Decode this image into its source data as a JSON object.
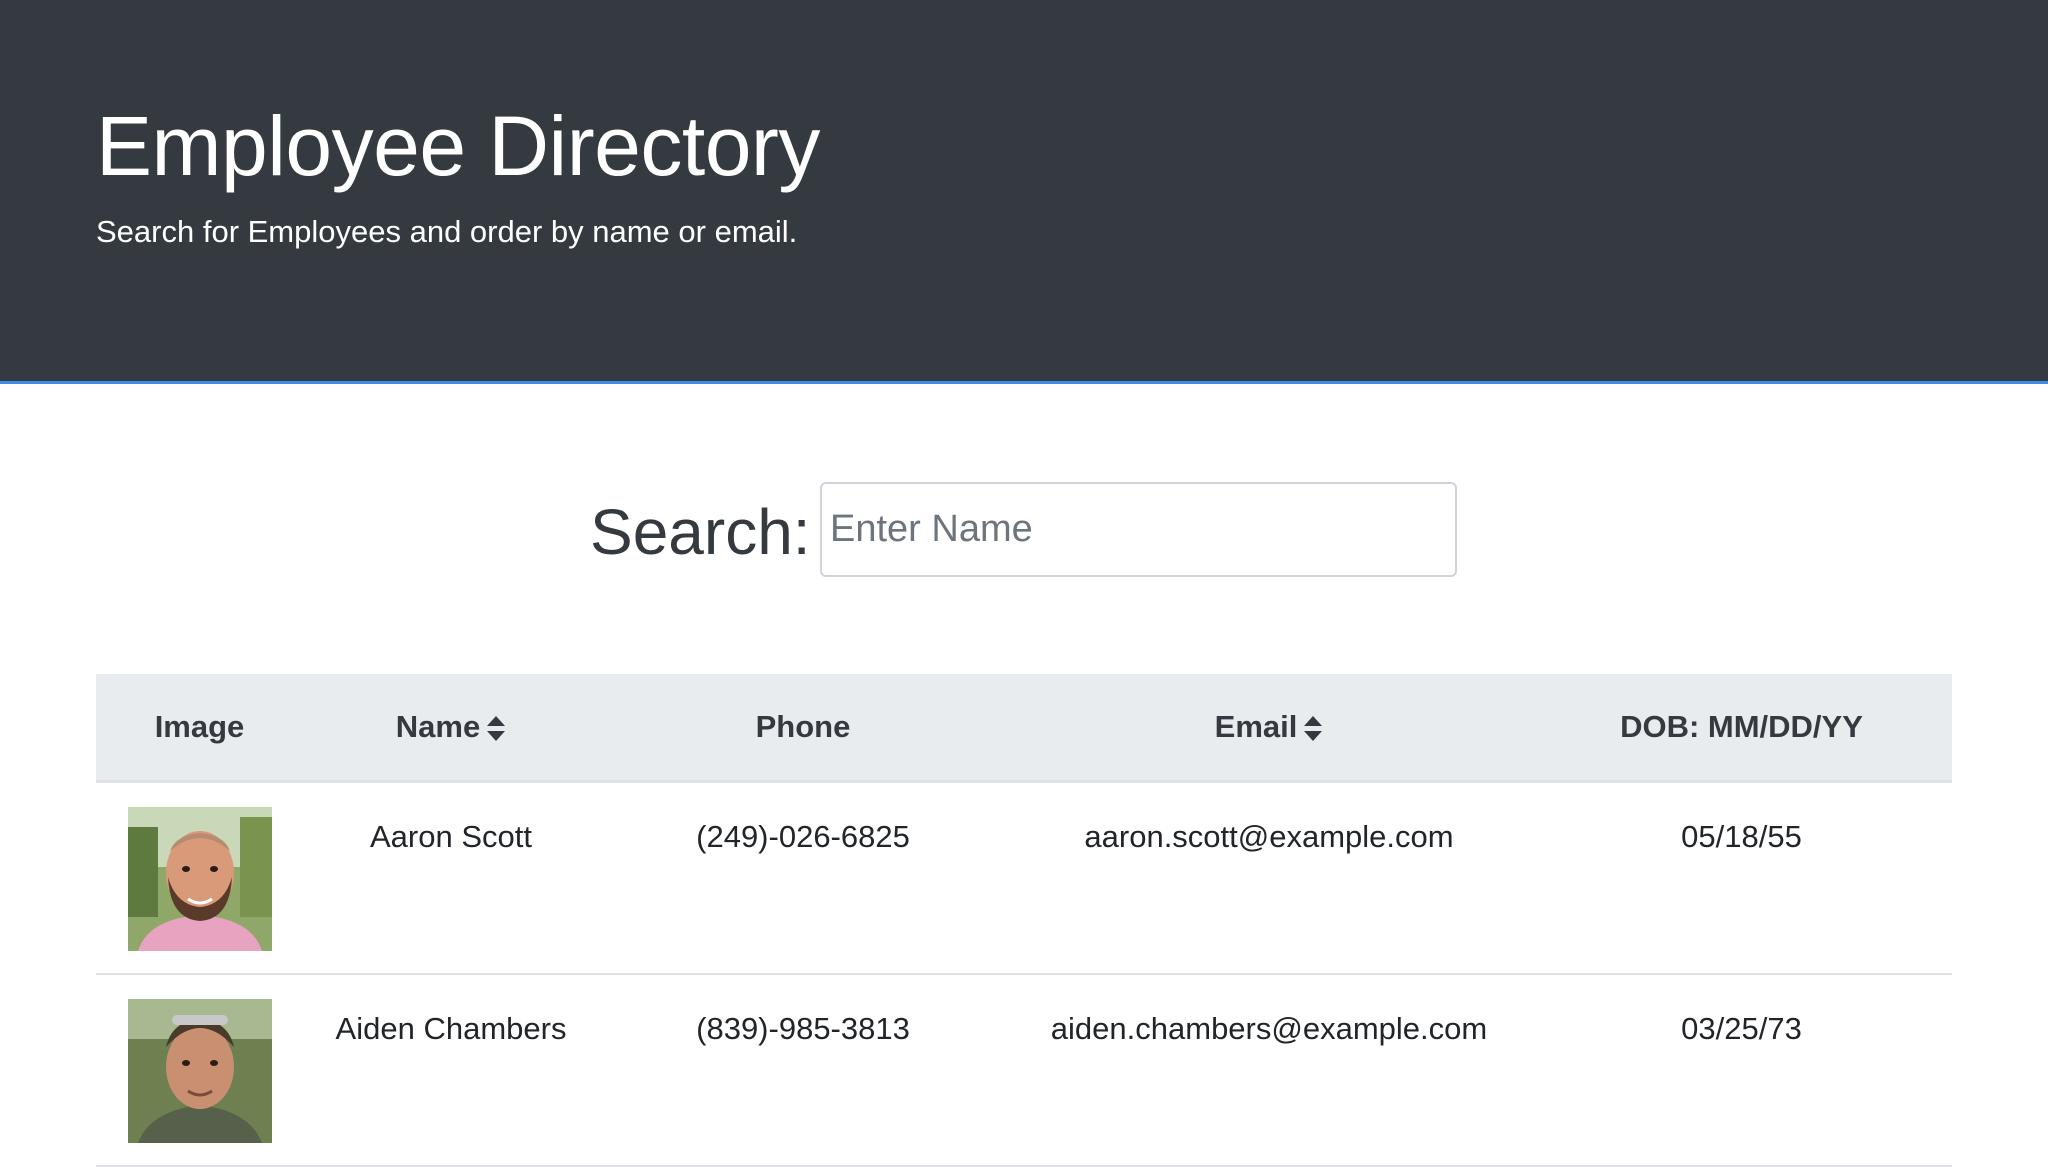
{
  "header": {
    "title": "Employee Directory",
    "subtitle": "Search for Employees and order by name or email."
  },
  "search": {
    "label": "Search:",
    "placeholder": "Enter Name",
    "value": ""
  },
  "table": {
    "columns": {
      "image": "Image",
      "name": "Name",
      "phone": "Phone",
      "email": "Email",
      "dob": "DOB: MM/DD/YY"
    },
    "rows": [
      {
        "name": "Aaron Scott",
        "phone": "(249)-026-6825",
        "email": "aaron.scott@example.com",
        "dob": "05/18/55",
        "avatar_icon": "person-photo-icon"
      },
      {
        "name": "Aiden Chambers",
        "phone": "(839)-985-3813",
        "email": "aiden.chambers@example.com",
        "dob": "03/25/73",
        "avatar_icon": "person-photo-icon"
      }
    ]
  },
  "colors": {
    "header_bg": "#343a40",
    "header_border": "#3a8ee6",
    "table_head_bg": "#e9ecef"
  }
}
